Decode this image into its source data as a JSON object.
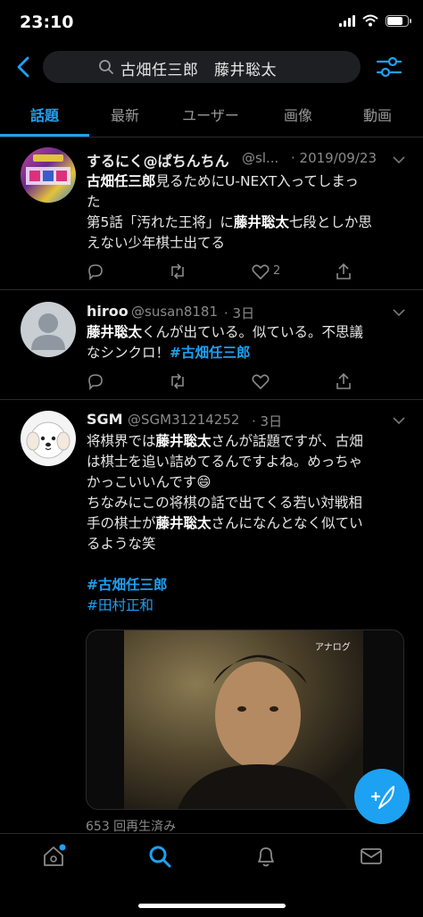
{
  "status": {
    "time": "23:10"
  },
  "search": {
    "query": "古畑任三郎　藤井聡太"
  },
  "tabs": [
    "話題",
    "最新",
    "ユーザー",
    "画像",
    "動画"
  ],
  "tweets": [
    {
      "name": "するにく@ぱちんちん",
      "handle": "@sl...",
      "date": "· 2019/09/23",
      "line1_hl": "古畑任三郎",
      "line1_rest": "見るためにU-NEXT入ってしまっ",
      "line2": "た",
      "line3_a": "第5話「汚れた王将」に",
      "line3_hl": "藤井聡太",
      "line3_b": "七段としか思",
      "line4": "えない少年棋士出てる",
      "like_count": "2"
    },
    {
      "name": "hiroo",
      "handle": "@susan8181",
      "date": "· 3日",
      "line1_hl": "藤井聡太",
      "line1_rest": "くんが出ている。似ている。不思議",
      "line2_a": "なシンクロ！",
      "line2_tag": "#古畑任三郎"
    },
    {
      "name": "SGM",
      "handle": "@SGM31214252",
      "date": "· 3日",
      "line1_a": "将棋界では",
      "line1_hl": "藤井聡太",
      "line1_b": "さんが話題ですが、古畑",
      "line2": "は棋士を追い詰めてるんですよね。めっちゃ",
      "line3": "かっこいいんです😄",
      "line4": "ちなみにこの将棋の話で出てくる若い対戦相",
      "line5_a": "手の棋士が",
      "line5_hl": "藤井聡太",
      "line5_b": "さんになんとなく似てい",
      "line6": "るような笑",
      "tag1": "#古畑任三郎",
      "tag2": "#田村正和",
      "video_watermark": "アナログ",
      "views": "653 回再生済み"
    }
  ],
  "icons": {
    "back": "chevron-left-icon",
    "filter": "sliders-icon",
    "reply": "reply-icon",
    "retweet": "retweet-icon",
    "like": "heart-icon",
    "share": "share-icon",
    "compose": "compose-feather-icon",
    "nav": [
      "home-icon",
      "search-icon",
      "bell-icon",
      "mail-icon"
    ]
  },
  "colors": {
    "accent": "#1da1f2",
    "background": "#000000",
    "text": "#e6e6e6",
    "muted": "#8a8a8a"
  }
}
